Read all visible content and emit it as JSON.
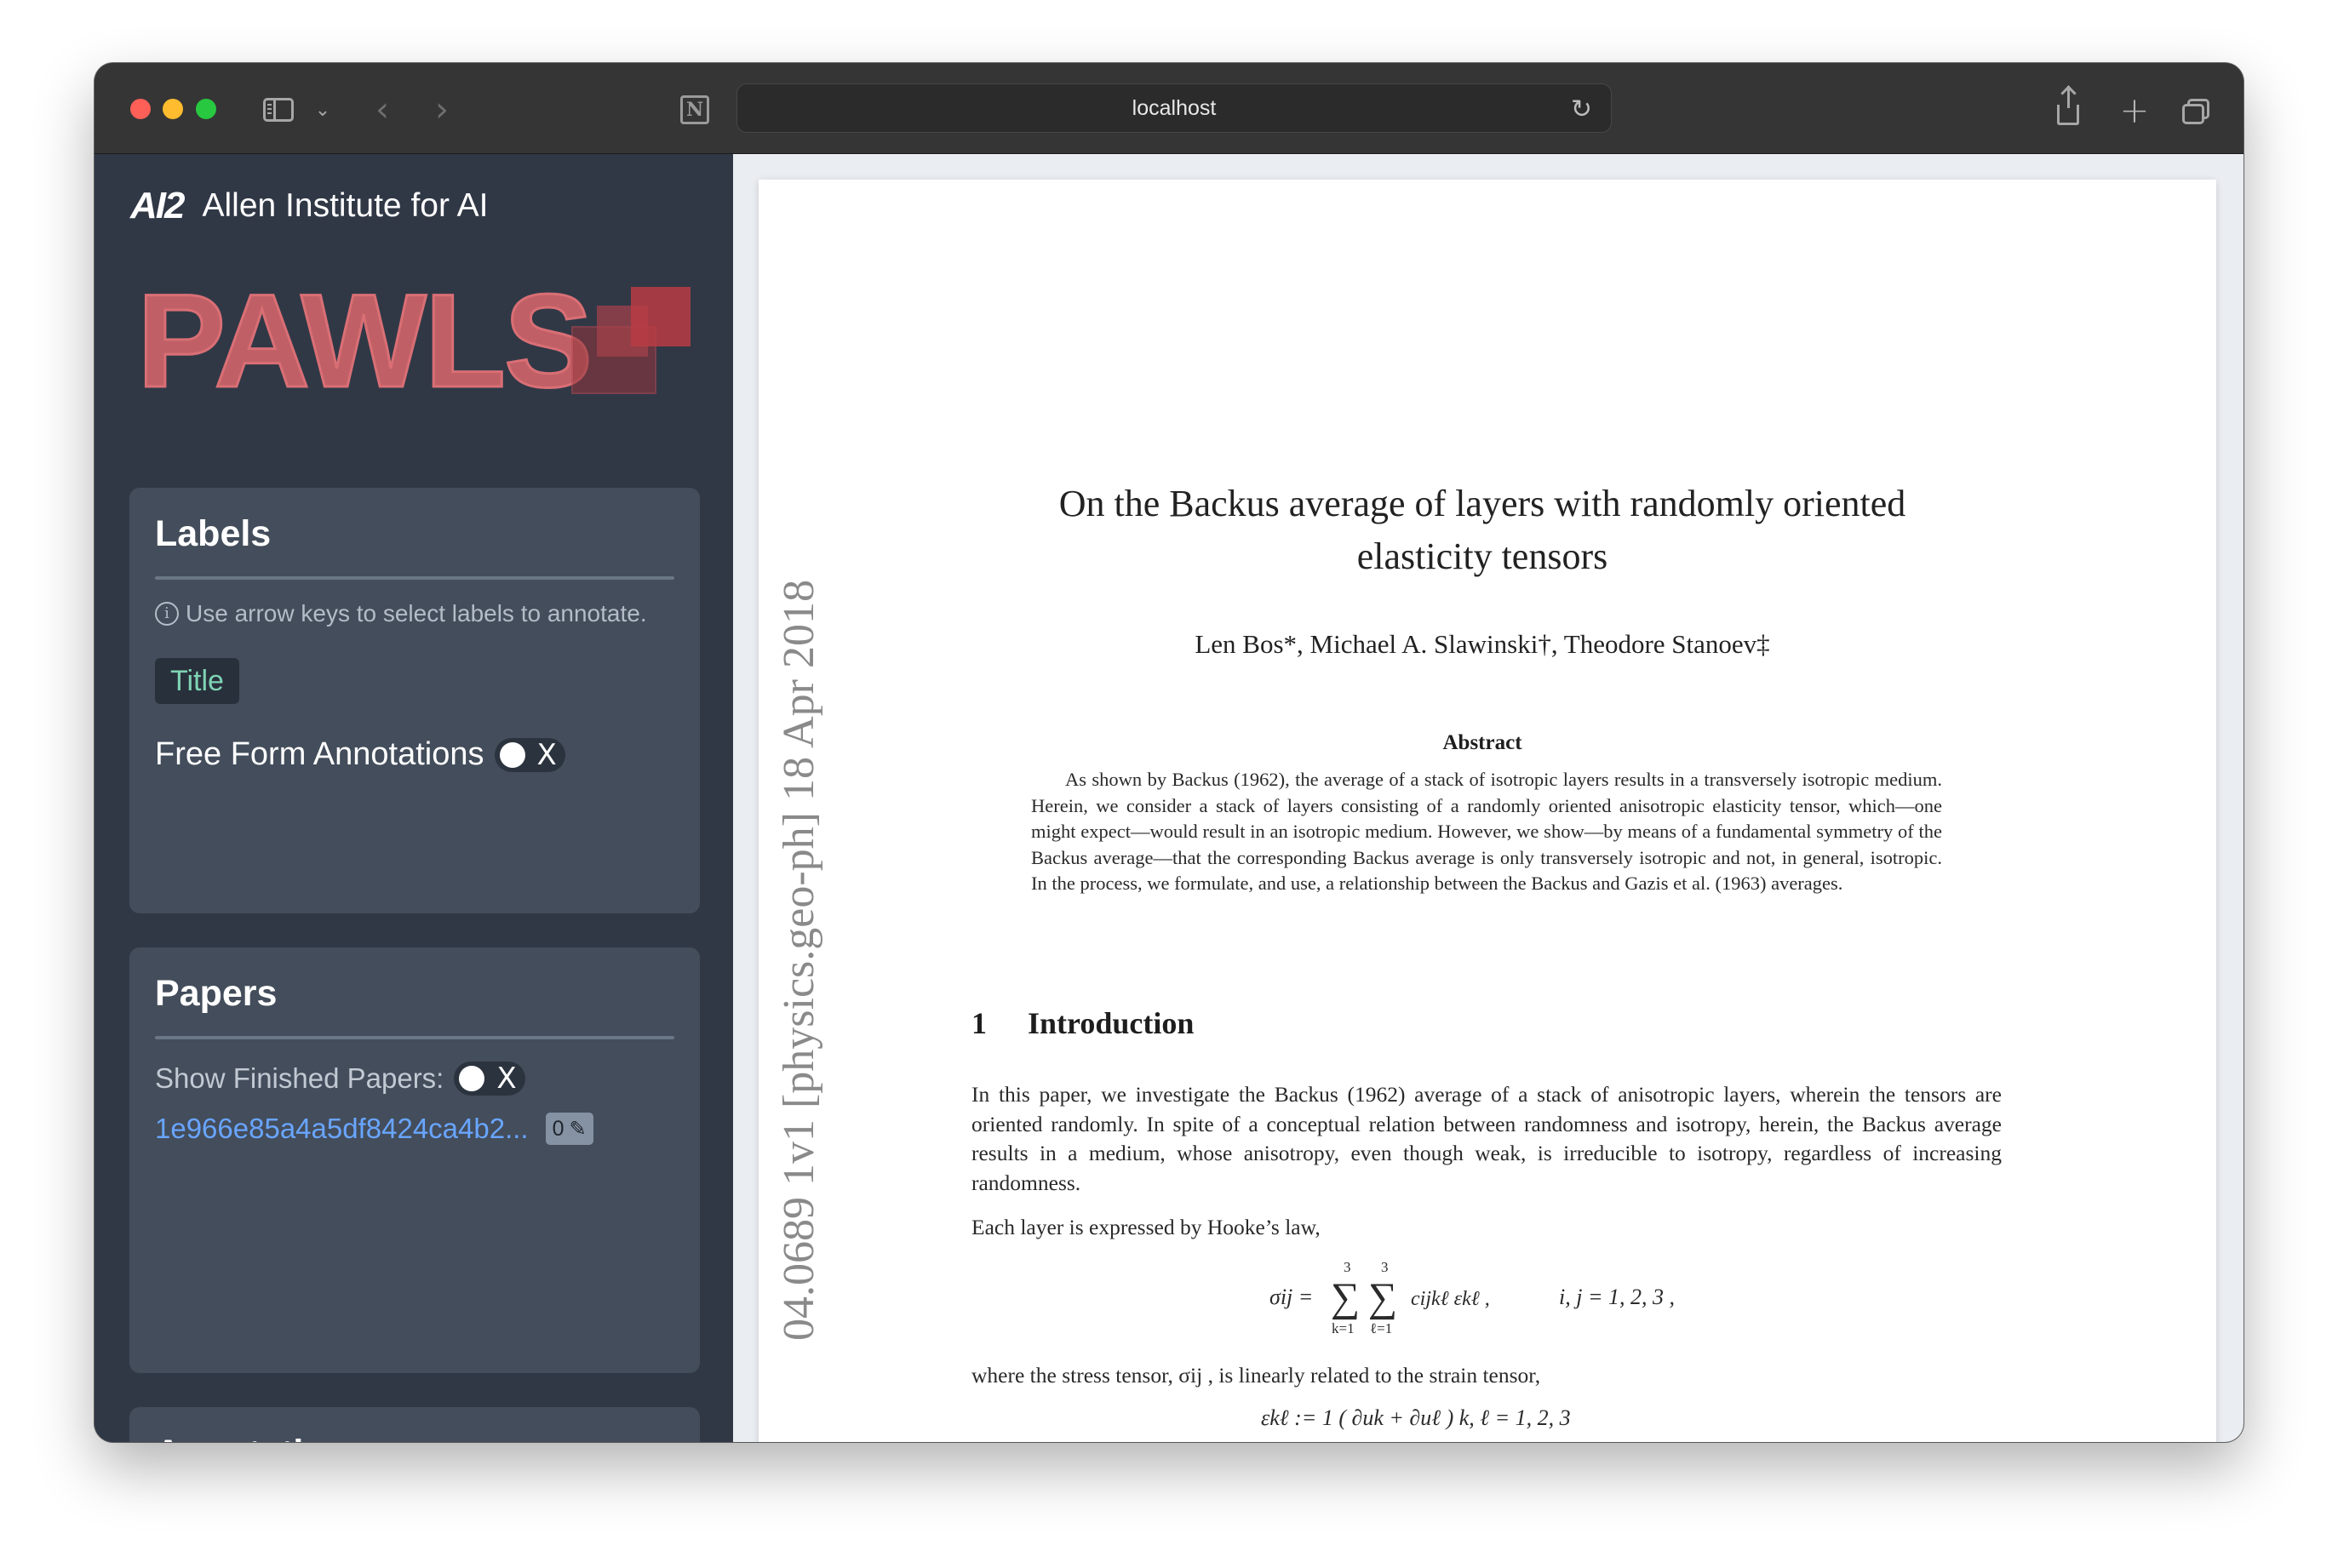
{
  "browser": {
    "url": "localhost",
    "icons": [
      "sidebar-icon",
      "chevron-down-icon",
      "back-arrow-icon",
      "forward-arrow-icon",
      "notion-icon",
      "reload-icon",
      "share-icon",
      "plus-icon",
      "tabs-icon"
    ]
  },
  "sidebar": {
    "brand_logo": "AI2",
    "brand_name": "Allen Institute for AI",
    "app_name": "PAWLS",
    "labels_panel": {
      "title": "Labels",
      "hint": "Use arrow keys to select labels to annotate.",
      "labels": [
        {
          "label": "Title",
          "color": "#7fd3b4"
        }
      ],
      "free_form_label": "Free Form Annotations",
      "free_form_toggle_x": "X"
    },
    "papers_panel": {
      "title": "Papers",
      "show_finished_label": "Show Finished Papers:",
      "show_finished_toggle_x": "X",
      "papers": [
        {
          "id_text": "1e966e85a4a5df8424ca4b2...",
          "annotation_count": "0"
        }
      ]
    },
    "annotations_panel": {
      "title": "Annotations"
    }
  },
  "pdf": {
    "arxiv_stamp": "04.0689 1v1  [physics.geo-ph]  18 Apr 2018",
    "title": "On the Backus average of layers with randomly oriented elasticity tensors",
    "authors": "Len Bos*, Michael A. Slawinski†, Theodore Stanoev‡",
    "abstract_heading": "Abstract",
    "abstract_text": "As shown by Backus (1962), the average of a stack of isotropic layers results in a transversely isotropic medium. Herein, we consider a stack of layers consisting of a randomly oriented anisotropic elasticity tensor, which—one might expect—would result in an isotropic medium. However, we show—by means of a fundamental symmetry of the Backus average—that the corresponding Backus average is only transversely isotropic and not, in general, isotropic. In the process, we formulate, and use, a relationship between the Backus and Gazis et al. (1963) averages.",
    "section_number": "1",
    "section_title": "Introduction",
    "intro_paragraph_1": "In this paper, we investigate the Backus (1962) average of a stack of anisotropic layers, wherein the tensors are oriented randomly. In spite of a conceptual relation between randomness and isotropy, herein, the Backus average results in a medium, whose anisotropy, even though weak, is irreducible to isotropy, regardless of increasing randomness.",
    "intro_paragraph_2": "Each layer is expressed by Hooke’s law,",
    "equation_1": {
      "lhs": "σij =",
      "sum_upper": "3",
      "sum_lower_1": "k=1",
      "sum_lower_2": "ℓ=1",
      "rhs": "cijkℓ εkℓ ,",
      "range": "i, j = 1, 2, 3 ,"
    },
    "where_text": "where the stress tensor, σij , is linearly related to the strain tensor,",
    "equation_2_partial": "εkℓ :=  1 ( ∂uk + ∂uℓ )        k, ℓ = 1, 2, 3"
  }
}
